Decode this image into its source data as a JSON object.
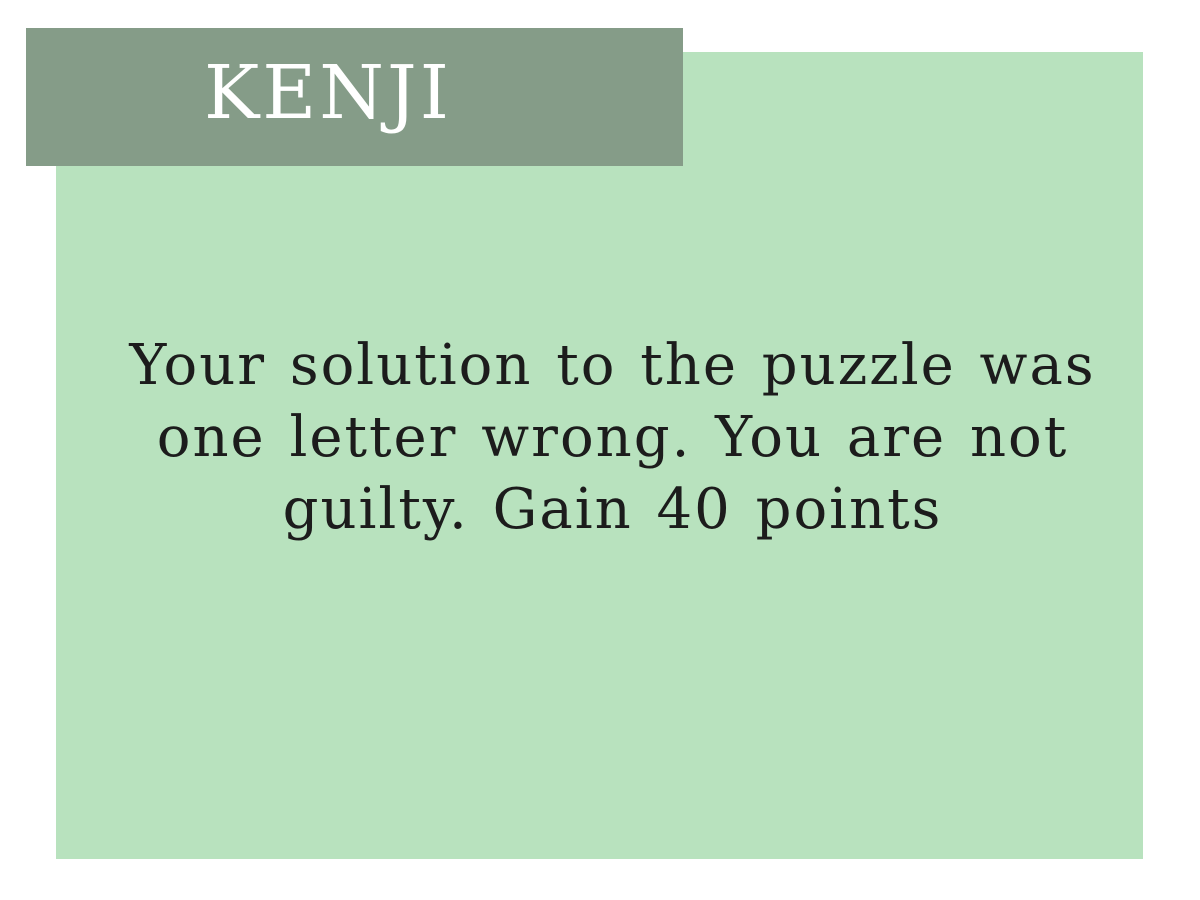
{
  "card": {
    "character_name": "KENJI",
    "message": "Your solution to the puzzle was one letter wrong. You are not guilty. Gain 40 points"
  },
  "colors": {
    "card_background": "#b8e2be",
    "banner_background": "#859c88",
    "banner_text": "#ffffff",
    "message_text": "#1c1c1c"
  }
}
